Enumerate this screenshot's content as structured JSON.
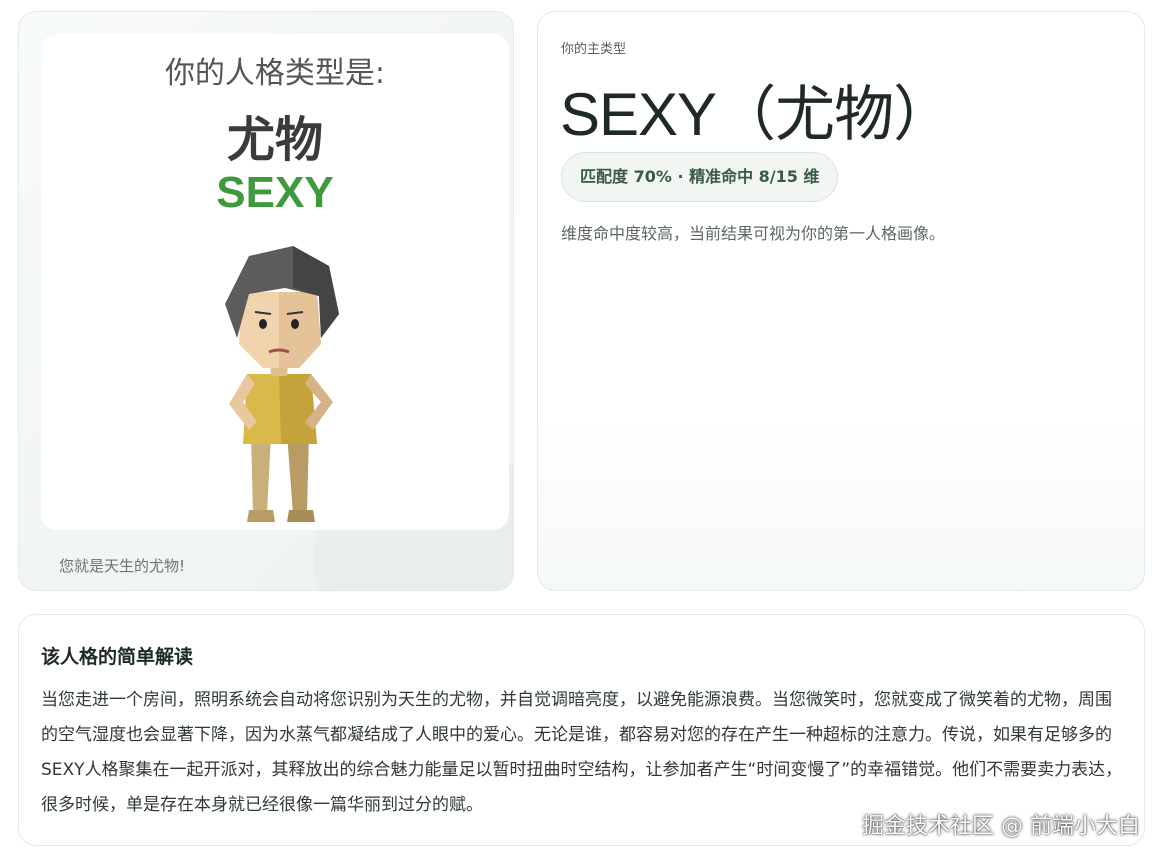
{
  "image_card": {
    "poster_heading": "你的人格类型是:",
    "poster_name": "尤物",
    "poster_code": "SEXY",
    "caption": "您就是天生的尤物!"
  },
  "summary": {
    "label": "你的主类型",
    "title": "SEXY（尤物）",
    "match_badge": "匹配度 70% · 精准命中 8/15 维",
    "description": "维度命中度较高，当前结果可视为你的第一人格画像。"
  },
  "detail": {
    "title": "该人格的简单解读",
    "body": "当您走进一个房间，照明系统会自动将您识别为天生的尤物，并自觉调暗亮度，以避免能源浪费。当您微笑时，您就变成了微笑着的尤物，周围的空气湿度也会显著下降，因为水蒸气都凝结成了人眼中的爱心。无论是谁，都容易对您的存在产生一种超标的注意力。传说，如果有足够多的SEXY人格聚集在一起开派对，其释放出的综合魅力能量足以暂时扭曲时空结构，让参加者产生“时间变慢了”的幸福错觉。他们不需要卖力表达，很多时候，单是存在本身就已经很像一篇华丽到过分的赋。"
  },
  "watermark": "掘金技术社区 @ 前端小大白",
  "colors": {
    "accent_green": "#3f9a3f",
    "badge_bg": "#f1f6f2",
    "border": "#e3ebe5"
  }
}
